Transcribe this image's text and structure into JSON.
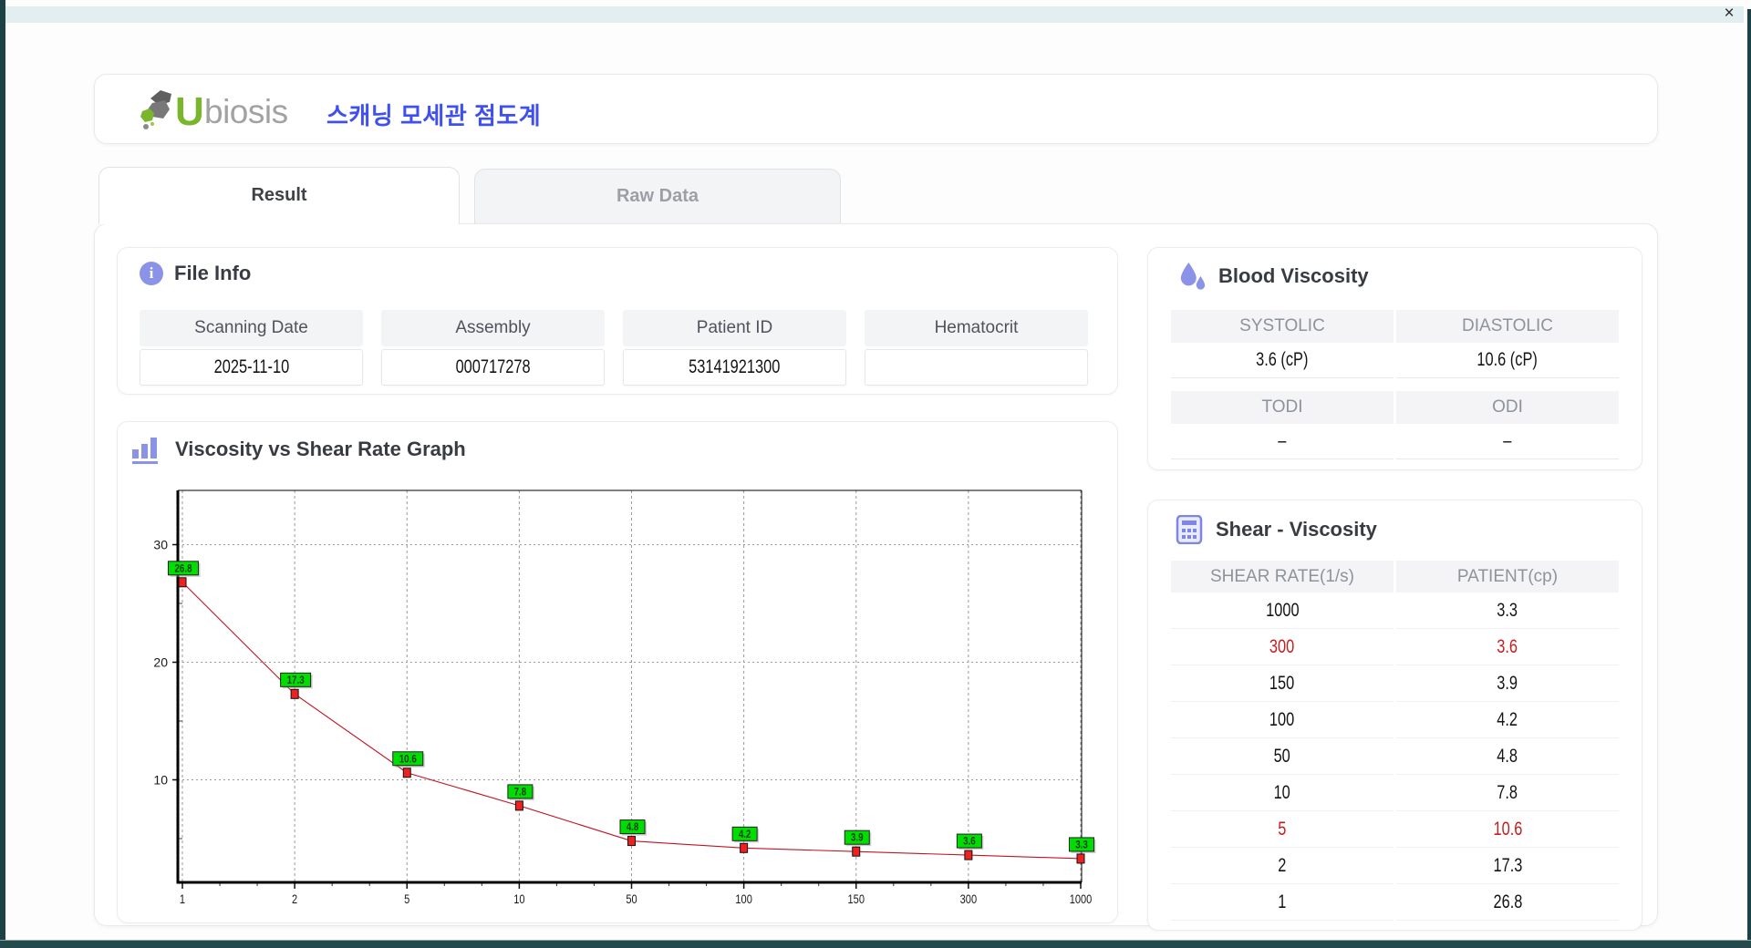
{
  "window": {
    "close_label": "×"
  },
  "header": {
    "brand_u": "U",
    "brand_rest": "biosis",
    "title_ko": "스캐닝 모세관 점도계"
  },
  "tabs": {
    "result": "Result",
    "raw": "Raw Data"
  },
  "file_info": {
    "heading": "File Info",
    "fields": [
      {
        "label": "Scanning Date",
        "value": "2025-11-10"
      },
      {
        "label": "Assembly",
        "value": "000717278"
      },
      {
        "label": "Patient ID",
        "value": "53141921300"
      },
      {
        "label": "Hematocrit",
        "value": ""
      }
    ]
  },
  "blood_viscosity": {
    "heading": "Blood Viscosity",
    "row1": {
      "col1_label": "SYSTOLIC",
      "col1_value": "3.6 (cP)",
      "col2_label": "DIASTOLIC",
      "col2_value": "10.6 (cP)"
    },
    "row2": {
      "col1_label": "TODI",
      "col1_value": "–",
      "col2_label": "ODI",
      "col2_value": "–"
    }
  },
  "shear_viscosity": {
    "heading": "Shear - Viscosity",
    "columns": [
      "SHEAR RATE(1/s)",
      "PATIENT(cp)"
    ],
    "rows": [
      {
        "rate": "1000",
        "value": "3.3",
        "highlight": false
      },
      {
        "rate": "300",
        "value": "3.6",
        "highlight": true
      },
      {
        "rate": "150",
        "value": "3.9",
        "highlight": false
      },
      {
        "rate": "100",
        "value": "4.2",
        "highlight": false
      },
      {
        "rate": "50",
        "value": "4.8",
        "highlight": false
      },
      {
        "rate": "10",
        "value": "7.8",
        "highlight": false
      },
      {
        "rate": "5",
        "value": "10.6",
        "highlight": true
      },
      {
        "rate": "2",
        "value": "17.3",
        "highlight": false
      },
      {
        "rate": "1",
        "value": "26.8",
        "highlight": false
      }
    ]
  },
  "chart_data": {
    "type": "line",
    "title": "Viscosity vs Shear Rate Graph",
    "x": [
      1,
      2,
      5,
      10,
      50,
      100,
      150,
      300,
      1000
    ],
    "values": [
      26.8,
      17.3,
      10.6,
      7.8,
      4.8,
      4.2,
      3.9,
      3.6,
      3.3
    ],
    "yticks": [
      10,
      20,
      30
    ],
    "x_scale": "categorical",
    "grid": "dashed",
    "line_color": "#c11524",
    "marker_color": "#ee2020",
    "label_bg": "#00dd00"
  }
}
